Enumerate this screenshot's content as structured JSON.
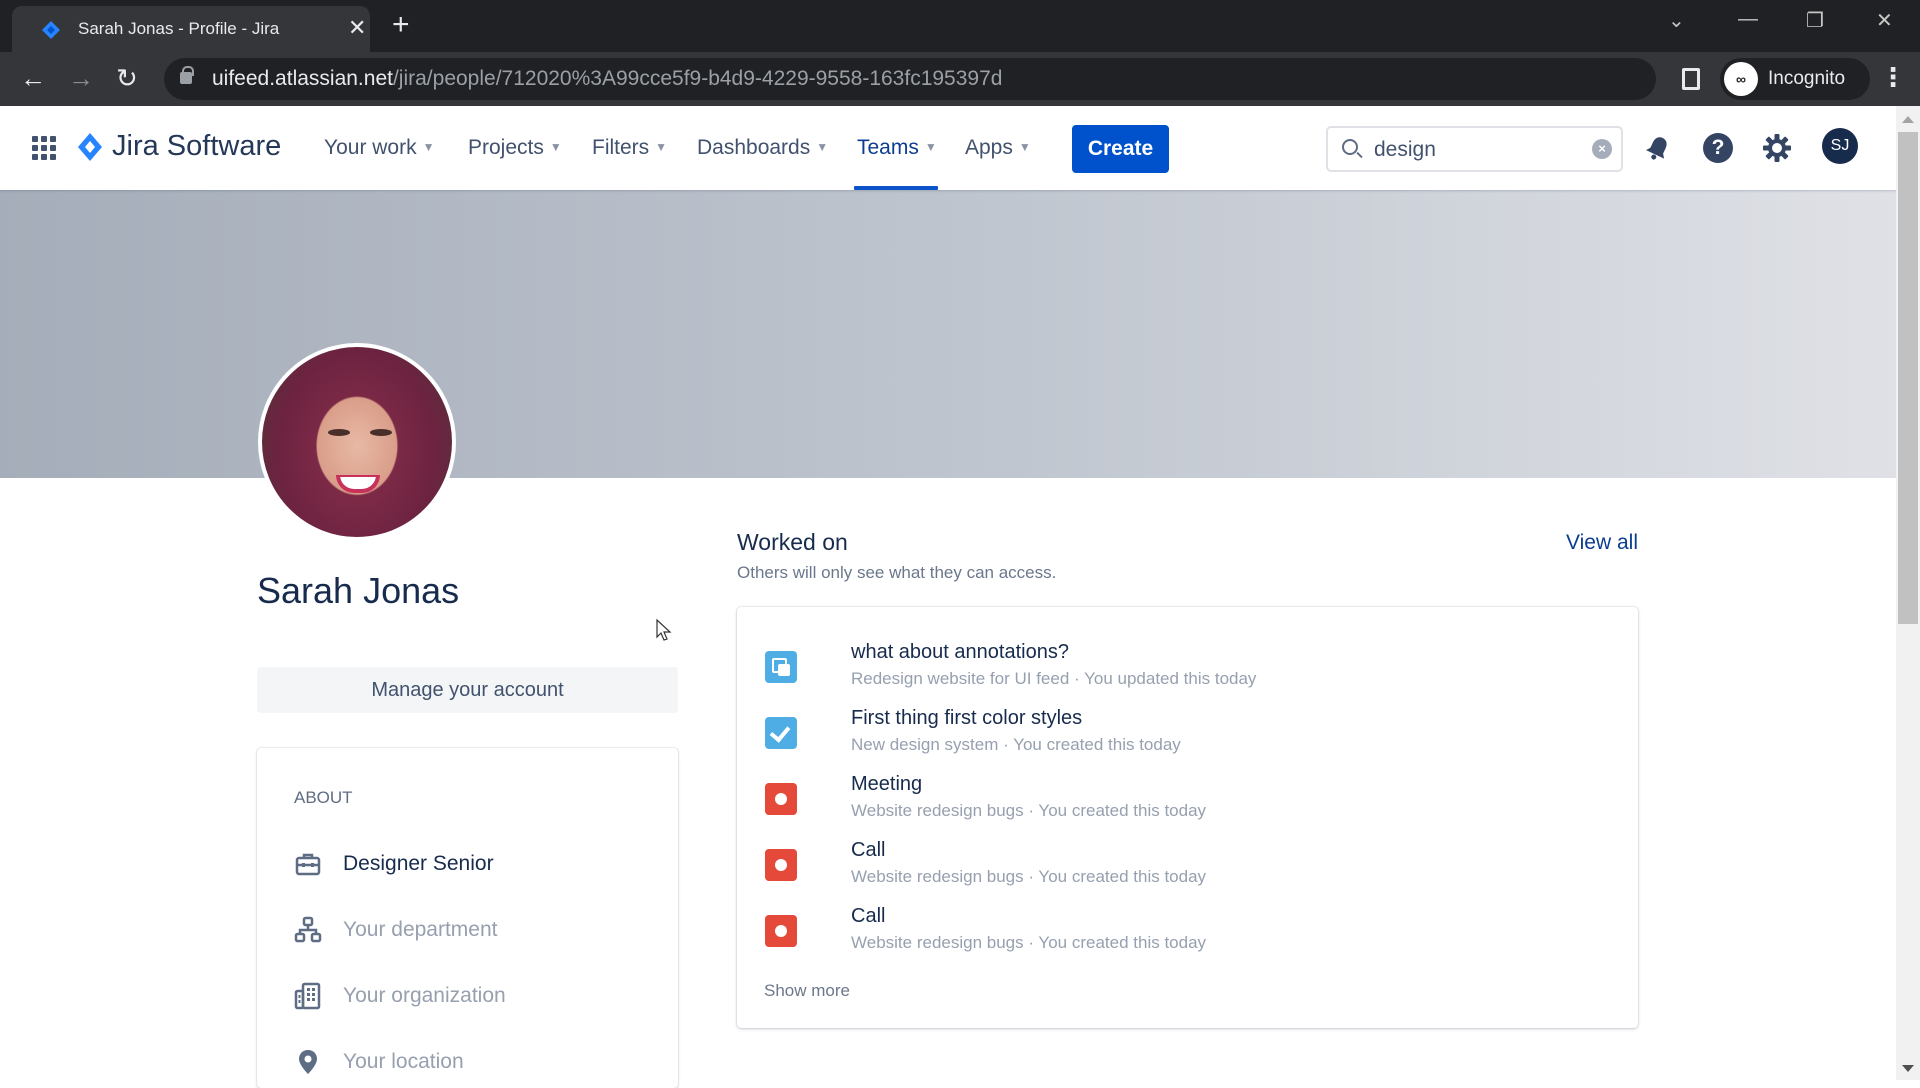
{
  "browser": {
    "tab_title": "Sarah Jonas - Profile - Jira",
    "url_host": "uifeed.atlassian.net",
    "url_path": "/jira/people/712020%3A99cce5f9-b4d9-4229-9558-163fc195397d",
    "profile_label": "Incognito",
    "icons": {
      "back": "←",
      "forward": "→",
      "reload": "↻",
      "star": "☆",
      "close": "✕",
      "new_tab": "+",
      "menu": "⋮",
      "tab_list": "⌄",
      "minimize": "—",
      "restore": "❐",
      "window_close": "✕"
    }
  },
  "nav": {
    "product_name": "Jira Software",
    "items": [
      {
        "label": "Your work",
        "active": false
      },
      {
        "label": "Projects",
        "active": false
      },
      {
        "label": "Filters",
        "active": false
      },
      {
        "label": "Dashboards",
        "active": false
      },
      {
        "label": "Teams",
        "active": true
      },
      {
        "label": "Apps",
        "active": false
      }
    ],
    "chevron": "⌄",
    "create_label": "Create",
    "search_value": "design",
    "search_clear": "×",
    "help_glyph": "?",
    "user_initials": "SJ",
    "accent_color": "#0052cc"
  },
  "profile": {
    "name": "Sarah Jonas",
    "manage_account_label": "Manage your account",
    "about": {
      "heading": "ABOUT",
      "items": [
        {
          "icon": "briefcase-icon",
          "label": "Designer Senior",
          "filled": true
        },
        {
          "icon": "department-icon",
          "label": "Your department",
          "filled": false
        },
        {
          "icon": "organization-icon",
          "label": "Your organization",
          "filled": false
        },
        {
          "icon": "location-icon",
          "label": "Your location",
          "filled": false
        }
      ]
    }
  },
  "worked_on": {
    "title": "Worked on",
    "subtitle": "Others will only see what they can access.",
    "view_all_label": "View all",
    "items": [
      {
        "type": "subtask",
        "title": "what about annotations?",
        "meta": "Redesign website for UI feed · You updated this today"
      },
      {
        "type": "task",
        "title": "First thing first color styles",
        "meta": "New design system · You created this today"
      },
      {
        "type": "bug",
        "title": "Meeting",
        "meta": "Website redesign bugs · You created this today"
      },
      {
        "type": "bug",
        "title": "Call",
        "meta": "Website redesign bugs · You created this today"
      },
      {
        "type": "bug",
        "title": "Call",
        "meta": "Website redesign bugs · You created this today"
      }
    ],
    "show_more_label": "Show more"
  }
}
